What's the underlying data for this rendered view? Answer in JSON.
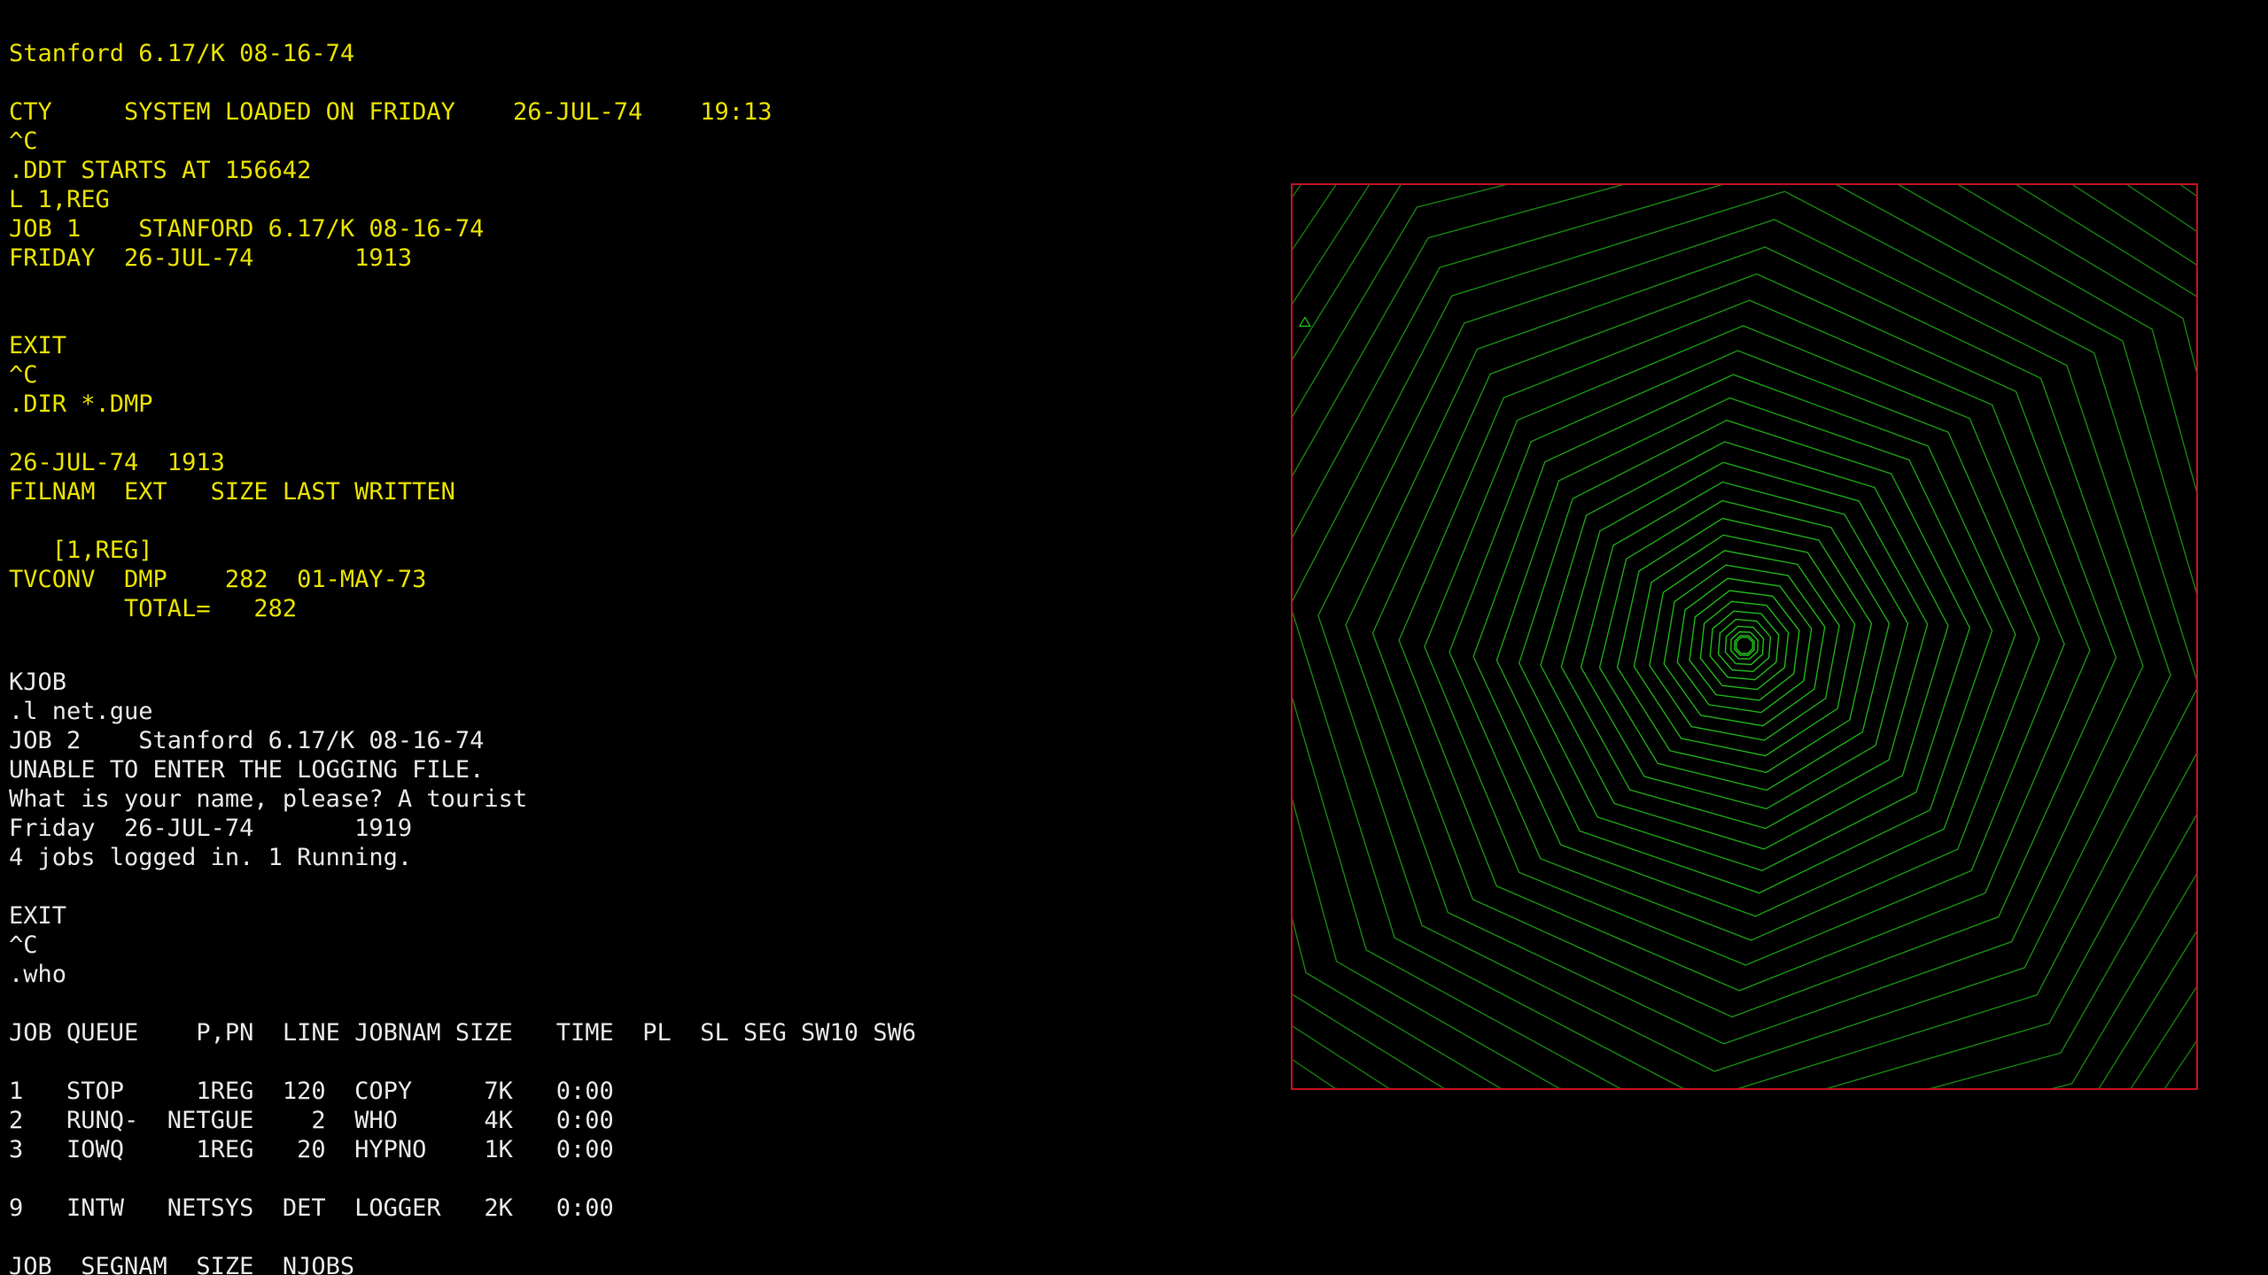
{
  "colors": {
    "background": "#000000",
    "amber_text": "#e8e100",
    "white_text": "#e8e8e8",
    "display_border": "#c1121f",
    "vector_green": "#23c41a"
  },
  "terminal": {
    "lines": [
      {
        "text": "Stanford 6.17/K 08-16-74",
        "color": "amber"
      },
      {
        "text": "",
        "color": "amber"
      },
      {
        "text": "CTY     SYSTEM LOADED ON FRIDAY    26-JUL-74    19:13",
        "color": "amber"
      },
      {
        "text": "^C",
        "color": "amber"
      },
      {
        "text": ".DDT STARTS AT 156642",
        "color": "amber"
      },
      {
        "text": "L 1,REG",
        "color": "amber"
      },
      {
        "text": "JOB 1    STANFORD 6.17/K 08-16-74",
        "color": "amber"
      },
      {
        "text": "FRIDAY  26-JUL-74       1913",
        "color": "amber"
      },
      {
        "text": "",
        "color": "amber"
      },
      {
        "text": "",
        "color": "amber"
      },
      {
        "text": "EXIT",
        "color": "amber"
      },
      {
        "text": "^C",
        "color": "amber"
      },
      {
        "text": ".DIR *.DMP",
        "color": "amber"
      },
      {
        "text": "",
        "color": "amber"
      },
      {
        "text": "26-JUL-74  1913",
        "color": "amber"
      },
      {
        "text": "FILNAM  EXT   SIZE LAST WRITTEN",
        "color": "amber"
      },
      {
        "text": "",
        "color": "amber"
      },
      {
        "text": "   [1,REG]",
        "color": "amber"
      },
      {
        "text": "TVCONV  DMP    282  01-MAY-73",
        "color": "amber"
      },
      {
        "text": "        TOTAL=   282",
        "color": "amber"
      },
      {
        "text": "",
        "color": "amber",
        "large_gap": true
      },
      {
        "text": "KJOB",
        "color": "white"
      },
      {
        "text": ".l net.gue",
        "color": "white"
      },
      {
        "text": "JOB 2    Stanford 6.17/K 08-16-74",
        "color": "white"
      },
      {
        "text": "UNABLE TO ENTER THE LOGGING FILE.",
        "color": "white"
      },
      {
        "text": "What is your name, please? A tourist",
        "color": "white"
      },
      {
        "text": "Friday  26-JUL-74       1919",
        "color": "white"
      },
      {
        "text": "4 jobs logged in. 1 Running.",
        "color": "white"
      },
      {
        "text": "",
        "color": "white"
      },
      {
        "text": "EXIT",
        "color": "white"
      },
      {
        "text": "^C",
        "color": "white"
      },
      {
        "text": ".who",
        "color": "white"
      },
      {
        "text": "",
        "color": "white"
      },
      {
        "text": "JOB QUEUE    P,PN  LINE JOBNAM SIZE   TIME  PL  SL SEG SW10 SW6",
        "color": "white"
      },
      {
        "text": "",
        "color": "white"
      },
      {
        "text": "1   STOP     1REG  120  COPY     7K   0:00",
        "color": "white"
      },
      {
        "text": "2   RUNQ-  NETGUE    2  WHO      4K   0:00",
        "color": "white"
      },
      {
        "text": "3   IOWQ     1REG   20  HYPNO    1K   0:00",
        "color": "white"
      },
      {
        "text": "",
        "color": "white"
      },
      {
        "text": "9   INTW   NETSYS  DET  LOGGER   2K   0:00",
        "color": "white"
      },
      {
        "text": "",
        "color": "white"
      },
      {
        "text": "JOB  SEGNAM  SIZE  NJOBS",
        "color": "white"
      }
    ]
  },
  "display": {
    "name": "vector-display",
    "pattern": "nested-octagon-tunnel"
  }
}
